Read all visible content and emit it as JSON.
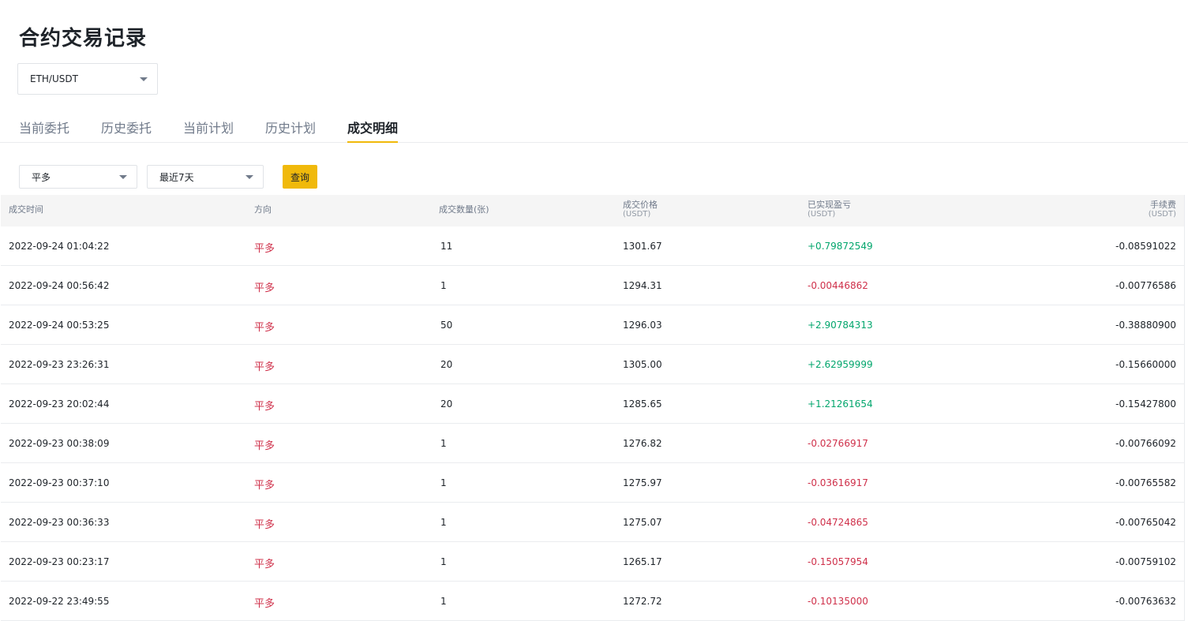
{
  "page_title": "合约交易记录",
  "pair_select": {
    "value": "ETH/USDT"
  },
  "tabs": [
    {
      "label": "当前委托",
      "active": false
    },
    {
      "label": "历史委托",
      "active": false
    },
    {
      "label": "当前计划",
      "active": false
    },
    {
      "label": "历史计划",
      "active": false
    },
    {
      "label": "成交明细",
      "active": true
    }
  ],
  "filters": {
    "direction": "平多",
    "period": "最近7天",
    "query_label": "查询"
  },
  "colors": {
    "accent": "#f0b90b",
    "profit": "#03a66d",
    "loss": "#cf304a"
  },
  "table": {
    "headers": {
      "time": "成交时间",
      "direction": "方向",
      "quantity": "成交数量(张)",
      "price": "成交价格",
      "price_unit": "(USDT)",
      "pnl": "已实现盈亏",
      "pnl_unit": "(USDT)",
      "fee": "手续费",
      "fee_unit": "(USDT)"
    },
    "rows": [
      {
        "time": "2022-09-24 01:04:22",
        "direction": "平多",
        "quantity": "11",
        "price": "1301.67",
        "pnl": "+0.79872549",
        "fee": "-0.08591022"
      },
      {
        "time": "2022-09-24 00:56:42",
        "direction": "平多",
        "quantity": "1",
        "price": "1294.31",
        "pnl": "-0.00446862",
        "fee": "-0.00776586"
      },
      {
        "time": "2022-09-24 00:53:25",
        "direction": "平多",
        "quantity": "50",
        "price": "1296.03",
        "pnl": "+2.90784313",
        "fee": "-0.38880900"
      },
      {
        "time": "2022-09-23 23:26:31",
        "direction": "平多",
        "quantity": "20",
        "price": "1305.00",
        "pnl": "+2.62959999",
        "fee": "-0.15660000"
      },
      {
        "time": "2022-09-23 20:02:44",
        "direction": "平多",
        "quantity": "20",
        "price": "1285.65",
        "pnl": "+1.21261654",
        "fee": "-0.15427800"
      },
      {
        "time": "2022-09-23 00:38:09",
        "direction": "平多",
        "quantity": "1",
        "price": "1276.82",
        "pnl": "-0.02766917",
        "fee": "-0.00766092"
      },
      {
        "time": "2022-09-23 00:37:10",
        "direction": "平多",
        "quantity": "1",
        "price": "1275.97",
        "pnl": "-0.03616917",
        "fee": "-0.00765582"
      },
      {
        "time": "2022-09-23 00:36:33",
        "direction": "平多",
        "quantity": "1",
        "price": "1275.07",
        "pnl": "-0.04724865",
        "fee": "-0.00765042"
      },
      {
        "time": "2022-09-23 00:23:17",
        "direction": "平多",
        "quantity": "1",
        "price": "1265.17",
        "pnl": "-0.15057954",
        "fee": "-0.00759102"
      },
      {
        "time": "2022-09-22 23:49:55",
        "direction": "平多",
        "quantity": "1",
        "price": "1272.72",
        "pnl": "-0.10135000",
        "fee": "-0.00763632"
      }
    ]
  }
}
